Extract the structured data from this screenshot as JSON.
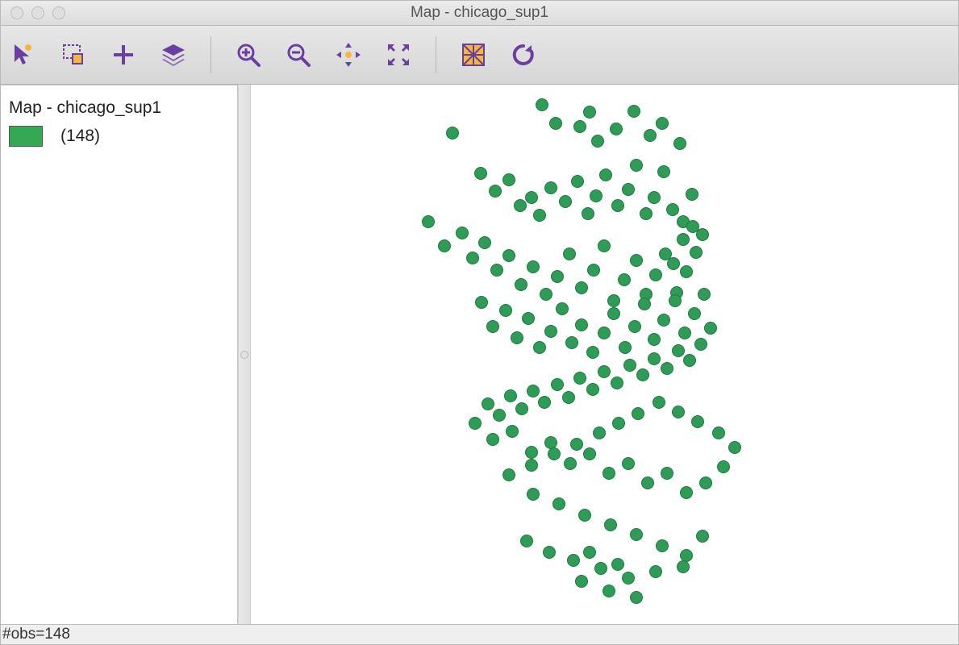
{
  "window": {
    "title": "Map - chicago_sup1"
  },
  "toolbar": {
    "select": "Select tool",
    "select_rect": "Rectangle select",
    "add": "Add",
    "layers": "Layers",
    "zoom_in": "Zoom in",
    "zoom_out": "Zoom out",
    "pan": "Pan",
    "full_extent": "Full extent",
    "basemap": "Basemap",
    "refresh": "Refresh"
  },
  "sidebar": {
    "title": "Map - chicago_sup1",
    "legend_count": "(148)"
  },
  "statusbar": {
    "obs": "#obs=148"
  },
  "colors": {
    "point_fill": "#2e9b57",
    "point_stroke": "#1f7a42",
    "accent": "#6b3fa0"
  },
  "chart_data": {
    "type": "scatter",
    "title": "Map - chicago_sup1",
    "n_obs": 148,
    "x_range": [
      0,
      880
    ],
    "y_range": [
      0,
      670
    ],
    "series": [
      {
        "name": "chicago_sup1",
        "color": "#2e9b57",
        "points": [
          [
            361,
            25
          ],
          [
            378,
            48
          ],
          [
            408,
            52
          ],
          [
            420,
            34
          ],
          [
            430,
            70
          ],
          [
            453,
            55
          ],
          [
            475,
            33
          ],
          [
            495,
            63
          ],
          [
            510,
            48
          ],
          [
            532,
            73
          ],
          [
            250,
            60
          ],
          [
            285,
            110
          ],
          [
            303,
            132
          ],
          [
            320,
            118
          ],
          [
            334,
            150
          ],
          [
            348,
            140
          ],
          [
            358,
            162
          ],
          [
            372,
            128
          ],
          [
            390,
            145
          ],
          [
            405,
            120
          ],
          [
            418,
            160
          ],
          [
            428,
            138
          ],
          [
            440,
            112
          ],
          [
            455,
            150
          ],
          [
            468,
            130
          ],
          [
            478,
            100
          ],
          [
            490,
            160
          ],
          [
            500,
            140
          ],
          [
            512,
            108
          ],
          [
            523,
            155
          ],
          [
            536,
            170
          ],
          [
            547,
            136
          ],
          [
            220,
            170
          ],
          [
            240,
            200
          ],
          [
            262,
            184
          ],
          [
            275,
            215
          ],
          [
            290,
            196
          ],
          [
            305,
            230
          ],
          [
            320,
            212
          ],
          [
            335,
            248
          ],
          [
            350,
            226
          ],
          [
            366,
            260
          ],
          [
            380,
            238
          ],
          [
            395,
            210
          ],
          [
            410,
            252
          ],
          [
            425,
            230
          ],
          [
            438,
            200
          ],
          [
            450,
            268
          ],
          [
            463,
            242
          ],
          [
            478,
            218
          ],
          [
            490,
            260
          ],
          [
            502,
            236
          ],
          [
            514,
            210
          ],
          [
            528,
            258
          ],
          [
            540,
            232
          ],
          [
            552,
            208
          ],
          [
            560,
            186
          ],
          [
            548,
            176
          ],
          [
            536,
            192
          ],
          [
            524,
            222
          ],
          [
            286,
            270
          ],
          [
            300,
            300
          ],
          [
            316,
            280
          ],
          [
            330,
            314
          ],
          [
            344,
            290
          ],
          [
            358,
            326
          ],
          [
            372,
            306
          ],
          [
            386,
            278
          ],
          [
            398,
            320
          ],
          [
            410,
            298
          ],
          [
            424,
            332
          ],
          [
            438,
            308
          ],
          [
            450,
            284
          ],
          [
            464,
            326
          ],
          [
            476,
            300
          ],
          [
            488,
            272
          ],
          [
            500,
            316
          ],
          [
            512,
            292
          ],
          [
            526,
            268
          ],
          [
            538,
            308
          ],
          [
            550,
            284
          ],
          [
            562,
            260
          ],
          [
            570,
            302
          ],
          [
            558,
            322
          ],
          [
            544,
            342
          ],
          [
            530,
            330
          ],
          [
            516,
            352
          ],
          [
            500,
            340
          ],
          [
            486,
            360
          ],
          [
            470,
            348
          ],
          [
            454,
            370
          ],
          [
            438,
            356
          ],
          [
            424,
            378
          ],
          [
            408,
            364
          ],
          [
            394,
            388
          ],
          [
            380,
            372
          ],
          [
            364,
            394
          ],
          [
            350,
            380
          ],
          [
            336,
            402
          ],
          [
            322,
            386
          ],
          [
            308,
            410
          ],
          [
            294,
            396
          ],
          [
            278,
            420
          ],
          [
            300,
            440
          ],
          [
            324,
            430
          ],
          [
            348,
            456
          ],
          [
            372,
            444
          ],
          [
            396,
            470
          ],
          [
            420,
            458
          ],
          [
            444,
            482
          ],
          [
            468,
            470
          ],
          [
            492,
            494
          ],
          [
            516,
            482
          ],
          [
            540,
            506
          ],
          [
            564,
            494
          ],
          [
            586,
            474
          ],
          [
            600,
            450
          ],
          [
            580,
            432
          ],
          [
            554,
            418
          ],
          [
            530,
            406
          ],
          [
            506,
            394
          ],
          [
            480,
            408
          ],
          [
            456,
            420
          ],
          [
            432,
            432
          ],
          [
            404,
            446
          ],
          [
            376,
            458
          ],
          [
            348,
            472
          ],
          [
            320,
            484
          ],
          [
            350,
            508
          ],
          [
            382,
            520
          ],
          [
            414,
            534
          ],
          [
            446,
            546
          ],
          [
            478,
            558
          ],
          [
            510,
            572
          ],
          [
            540,
            584
          ],
          [
            560,
            560
          ],
          [
            536,
            598
          ],
          [
            502,
            604
          ],
          [
            468,
            612
          ],
          [
            434,
            600
          ],
          [
            400,
            590
          ],
          [
            370,
            580
          ],
          [
            342,
            566
          ],
          [
            410,
            616
          ],
          [
            444,
            628
          ],
          [
            478,
            636
          ],
          [
            420,
            580
          ],
          [
            455,
            595
          ]
        ]
      }
    ]
  }
}
